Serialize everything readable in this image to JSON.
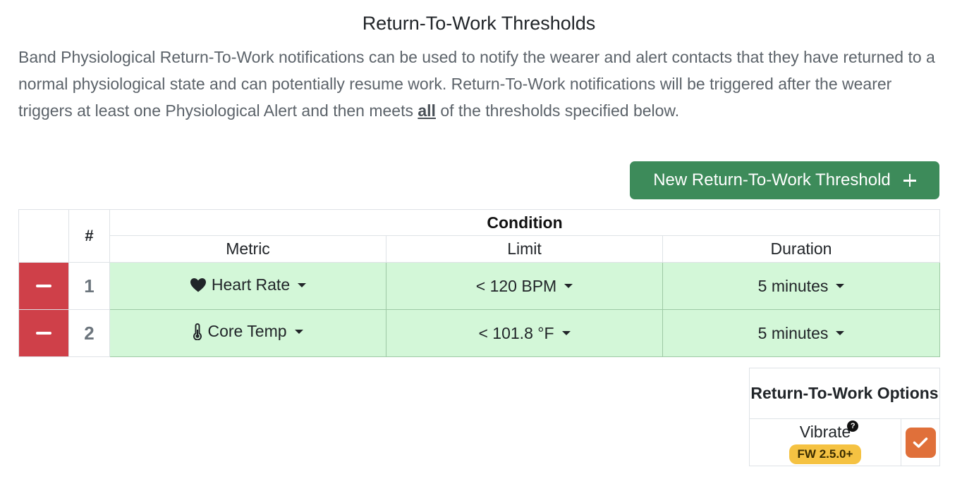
{
  "title": "Return-To-Work Thresholds",
  "description": {
    "before": "Band Physiological Return-To-Work notifications can be used to notify the wearer and alert contacts that they have returned to a normal physiological state and can potentially resume work. Return-To-Work notifications will be triggered after the wearer triggers at least one Physiological Alert and then meets ",
    "emphasis": "all",
    "after": " of the thresholds specified below."
  },
  "new_button_label": "New Return-To-Work Threshold",
  "table": {
    "hash_header": "#",
    "condition_header": "Condition",
    "columns": [
      "Metric",
      "Limit",
      "Duration"
    ],
    "rows": [
      {
        "index": "1",
        "icon": "heart-icon",
        "metric": "Heart Rate",
        "limit": "< 120 BPM",
        "duration": "5 minutes"
      },
      {
        "index": "2",
        "icon": "thermometer-icon",
        "metric": "Core Temp",
        "limit": "< 101.8 °F",
        "duration": "5 minutes"
      }
    ]
  },
  "options": {
    "title": "Return-To-Work Options",
    "vibrate_label": "Vibrate",
    "help_icon": "question-circle-icon",
    "firmware_badge": "FW 2.5.0+",
    "vibrate_checked": true
  },
  "colors": {
    "primary_button": "#3d8b5a",
    "remove_button": "#cf4049",
    "condition_row": "#d3f7d8",
    "checkbox": "#e0703a",
    "badge": "#f5c242"
  }
}
